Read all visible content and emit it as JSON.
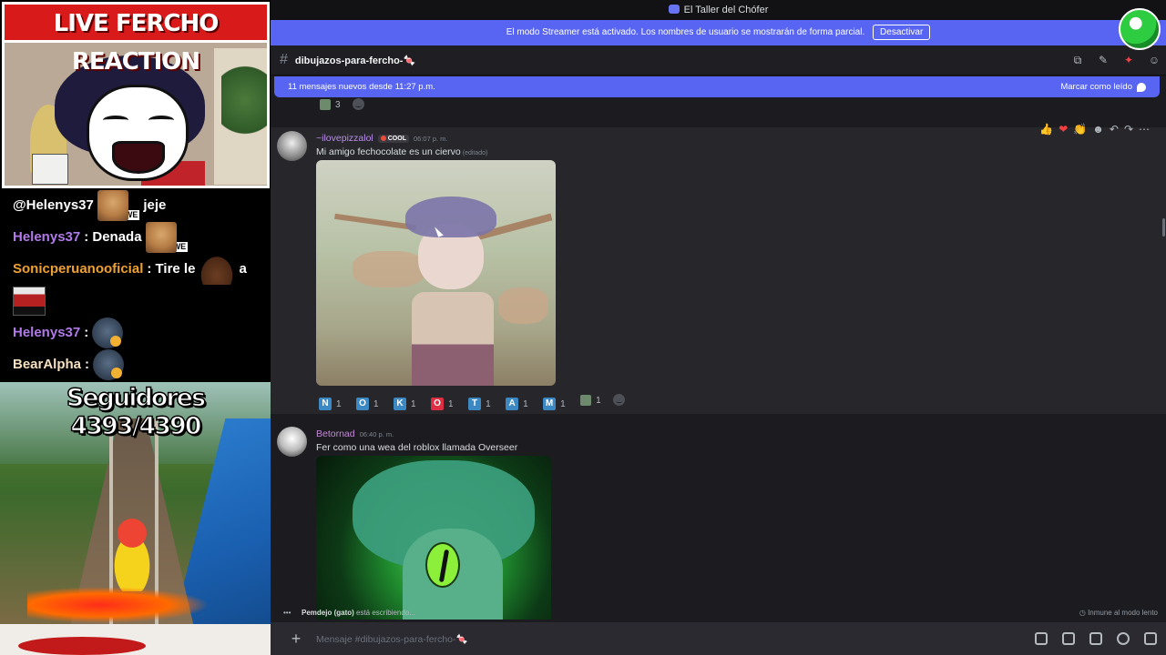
{
  "overlay": {
    "live_title": "LIVE FERCHO REACTION",
    "chat": [
      {
        "user": "@Helenys37",
        "text": "jeje",
        "user_color": "#ffffff"
      },
      {
        "user": "Helenys37",
        "text": ": Denada",
        "user_color": "#b07ae8"
      },
      {
        "user": "Sonicperuanooficial",
        "text": ": Tire le",
        "extra": "a",
        "user_color": "#f0a030"
      },
      {
        "user": "Helenys37",
        "text": ":",
        "user_color": "#b07ae8"
      },
      {
        "user": "BearAlpha",
        "text": ":",
        "user_color": "#f5e0c0"
      }
    ],
    "emote_we": "WE",
    "followers": "Seguidores 4393/4390"
  },
  "window": {
    "title": "El Taller del Chófer"
  },
  "streamer_bar": {
    "text": "El modo Streamer está activado. Los nombres de usuario se mostrarán de forma parcial.",
    "button": "Desactivar"
  },
  "channel": {
    "hash": "#",
    "name": "dibujazos-para-fercho-🍬"
  },
  "new_messages": {
    "text": "11 mensajes nuevos desde 11:27 p.m.",
    "mark_read": "Marcar como leído"
  },
  "top_reaction": {
    "count": "3"
  },
  "messages": [
    {
      "username": "~ilovepizzalol",
      "role_tag": "COOL",
      "timestamp": "06:07 p. m.",
      "text": "Mi amigo fechocolate es un ciervo",
      "edited": "(editado)",
      "reactions": [
        {
          "letter": "N",
          "count": "1",
          "color": "blue"
        },
        {
          "letter": "O",
          "count": "1",
          "color": "blue"
        },
        {
          "letter": "K",
          "count": "1",
          "color": "blue"
        },
        {
          "letter": "O",
          "count": "1",
          "color": "red"
        },
        {
          "letter": "T",
          "count": "1",
          "color": "blue"
        },
        {
          "letter": "A",
          "count": "1",
          "color": "blue"
        },
        {
          "letter": "M",
          "count": "1",
          "color": "blue"
        }
      ],
      "extra_reaction_count": "1"
    },
    {
      "username": "Betornad",
      "timestamp": "06:40 p. m.",
      "text": "Fer como una wea del roblox llamada Overseer"
    }
  ],
  "typing": {
    "user": "Pemdejo (gato)",
    "suffix": " está escribiendo...",
    "slowmode": "Inmune al modo lento"
  },
  "composer": {
    "placeholder": "Mensaje #dibujazos-para-fercho-🍬",
    "plus": "+"
  },
  "colors": {
    "blurple": "#5865f2",
    "live_red": "#d81a1a",
    "bg": "#1c1c20"
  }
}
